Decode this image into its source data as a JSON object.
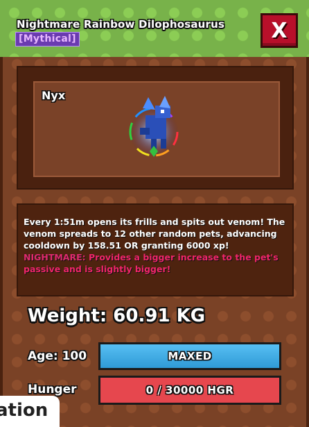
{
  "pet": {
    "title": "Nightmare Rainbow Dilophosaurus",
    "rarity": "[Mythical]",
    "name": "Nyx"
  },
  "close": {
    "label": "X"
  },
  "description": {
    "line1": "Every 1:51m opens its frills and spits out venom! The venom spreads to 12 other random pets, advancing cooldown by 158.51 OR granting 6000 xp!",
    "nightmare_prefix": "NIGHTMARE:",
    "nightmare_text": " Provides a bigger increase to the pet's passive and is slightly bigger!"
  },
  "stats": {
    "weight_label": "Weight: 60.91 KG",
    "age_label": "Age: 100",
    "age_bar_text": "MAXED",
    "age_progress": 1.0,
    "hunger_label": "Hunger",
    "hunger_bar_text": "0 / 30000 HGR",
    "hunger_progress": 0.0
  },
  "footer_tab": {
    "label": "ation"
  },
  "colors": {
    "rarity_mythical": "#6a3bb0",
    "close_red": "#b8102a",
    "nightmare_pink": "#e02a6f",
    "age_bar_blue": "#3aa8e4",
    "hunger_bar_red": "#e6474e"
  },
  "icons": {
    "close": "close-icon",
    "pet": "dilophosaurus-pet-icon"
  }
}
